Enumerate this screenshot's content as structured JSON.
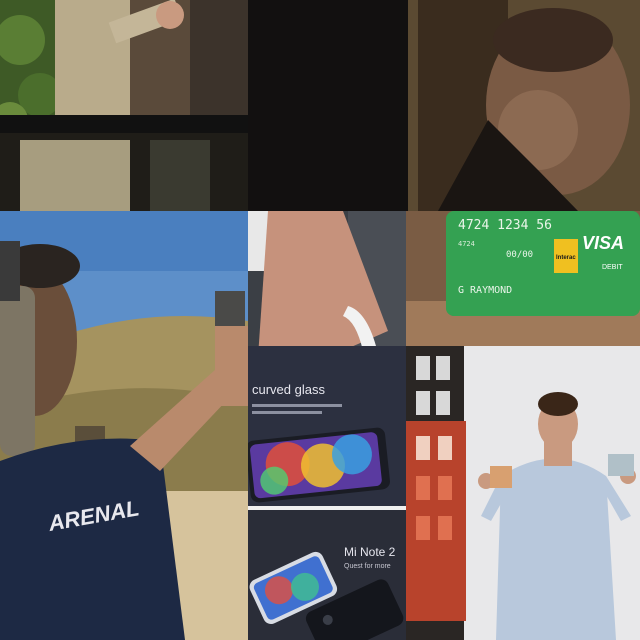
{
  "tiles": {
    "shooting": {
      "shirt_text": "ARENAL"
    },
    "card": {
      "number": "4724 1234 56",
      "small_number": "4724",
      "expiry": "00/00",
      "name": "G RAYMOND",
      "brand": "VISA",
      "type": "DEBIT",
      "network": "Interac"
    },
    "phone_ad": {
      "headline": "curved glass",
      "model": "Mi Note 2",
      "tagline": "Quest for more"
    }
  }
}
